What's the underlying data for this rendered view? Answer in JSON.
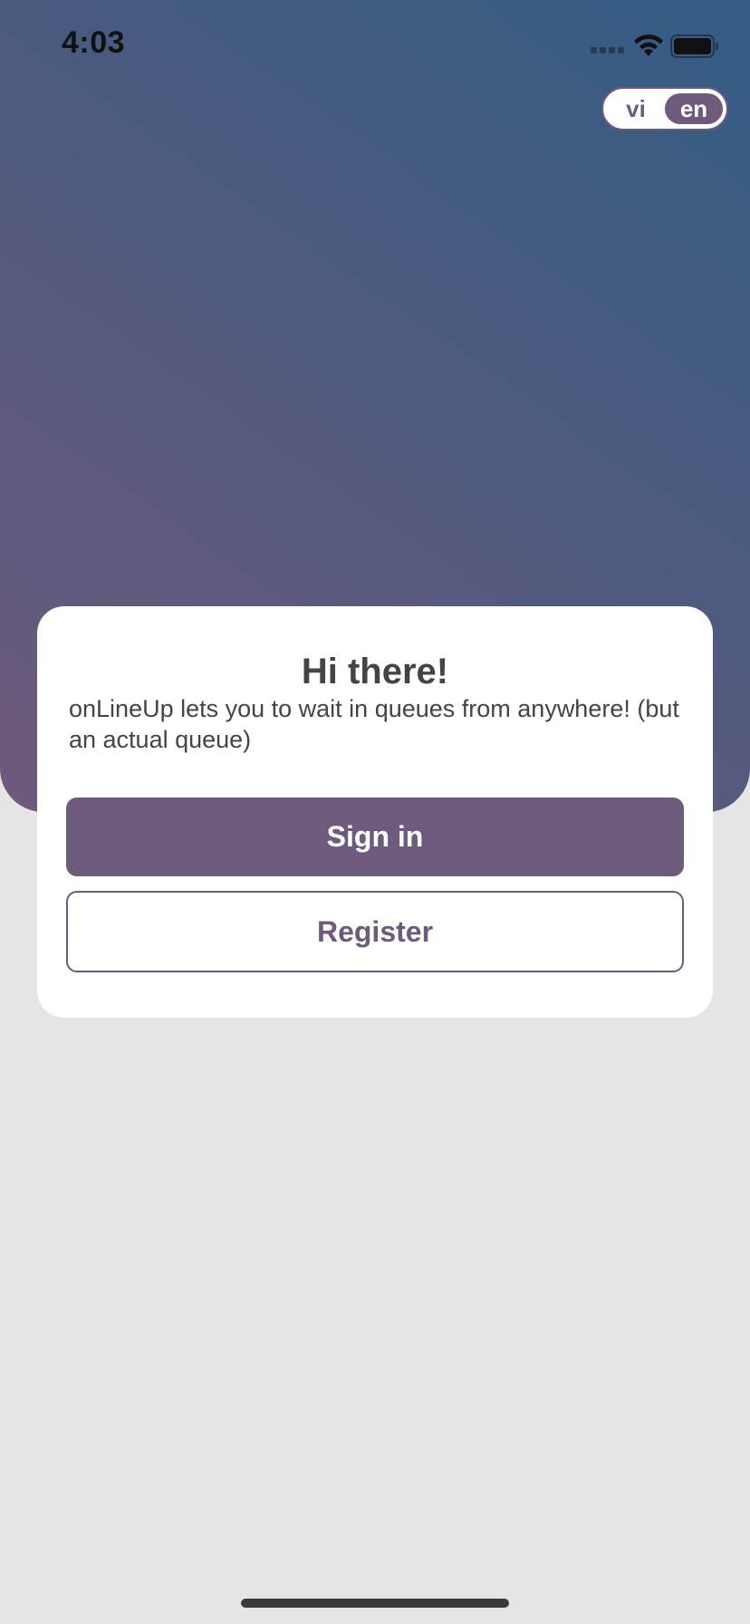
{
  "status_bar": {
    "time": "4:03"
  },
  "language_toggle": {
    "options": [
      "vi",
      "en"
    ],
    "selected": "en"
  },
  "card": {
    "title": "Hi there!",
    "subtitle": "onLineUp lets you to wait in queues from anywhere! (but an actual queue)",
    "sign_in_label": "Sign in",
    "register_label": "Register"
  },
  "colors": {
    "accent": "#6e5a7c",
    "gradient_top": "#335d84",
    "gradient_bottom": "#6e5a7c",
    "background": "#e5e5e5"
  }
}
